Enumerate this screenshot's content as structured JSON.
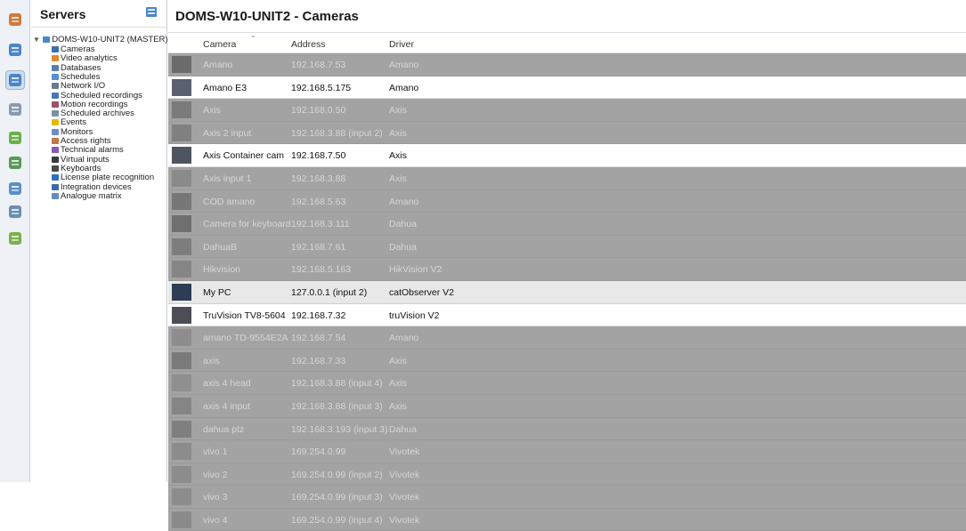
{
  "servers_panel": {
    "title": "Servers",
    "tree": {
      "root": "DOMS-W10-UNIT2 (MASTER)",
      "items": [
        {
          "label": "Cameras",
          "icon": "camera-icon",
          "color": "#3c6fb0"
        },
        {
          "label": "Video analytics",
          "icon": "analytics-icon",
          "color": "#e08a2c"
        },
        {
          "label": "Databases",
          "icon": "database-icon",
          "color": "#5a7fa8"
        },
        {
          "label": "Schedules",
          "icon": "schedule-icon",
          "color": "#5a8fd0"
        },
        {
          "label": "Network I/O",
          "icon": "network-io-icon",
          "color": "#6b7a8c"
        },
        {
          "label": "Scheduled recordings",
          "icon": "scheduled-recordings-icon",
          "color": "#4b76b8"
        },
        {
          "label": "Motion recordings",
          "icon": "motion-recordings-icon",
          "color": "#a0506a"
        },
        {
          "label": "Scheduled archives",
          "icon": "scheduled-archives-icon",
          "color": "#7b8fa8"
        },
        {
          "label": "Events",
          "icon": "events-icon",
          "color": "#e6b800"
        },
        {
          "label": "Monitors",
          "icon": "monitor-icon",
          "color": "#6a8fc8"
        },
        {
          "label": "Access rights",
          "icon": "access-rights-icon",
          "color": "#c07848"
        },
        {
          "label": "Technical alarms",
          "icon": "technical-alarms-icon",
          "color": "#8a5ab0"
        },
        {
          "label": "Virtual inputs",
          "icon": "virtual-inputs-icon",
          "color": "#3a3a3a"
        },
        {
          "label": "Keyboards",
          "icon": "keyboard-icon",
          "color": "#4a4a4a"
        },
        {
          "label": "License plate recognition",
          "icon": "lpr-icon",
          "color": "#2f6fbf"
        },
        {
          "label": "Integration devices",
          "icon": "integration-devices-icon",
          "color": "#3a6aa0"
        },
        {
          "label": "Analogue matrix",
          "icon": "analogue-matrix-icon",
          "color": "#5f8fbf"
        }
      ]
    }
  },
  "main": {
    "title": "DOMS-W10-UNIT2 - Cameras",
    "columns": {
      "camera": "Camera",
      "address": "Address",
      "driver": "Driver"
    },
    "rows": [
      {
        "camera": "Amano",
        "address": "192.168.7.53",
        "driver": "Amano",
        "state": "disabled"
      },
      {
        "camera": "Amano E3",
        "address": "192.168.5.175",
        "driver": "Amano",
        "state": "enabled"
      },
      {
        "camera": "Axis",
        "address": "192.168.0.50",
        "driver": "Axis",
        "state": "disabled"
      },
      {
        "camera": "Axis 2 input",
        "address": "192.168.3.88 (input 2)",
        "driver": "Axis",
        "state": "disabled"
      },
      {
        "camera": "Axis Container cam",
        "address": "192.168.7.50",
        "driver": "Axis",
        "state": "enabled"
      },
      {
        "camera": "Axis input 1",
        "address": "192.168.3.88",
        "driver": "Axis",
        "state": "disabled"
      },
      {
        "camera": "COD amano",
        "address": "192.168.5.63",
        "driver": "Amano",
        "state": "disabled"
      },
      {
        "camera": "Camera for keyboard",
        "address": "192.168.3.111",
        "driver": "Dahua",
        "state": "disabled"
      },
      {
        "camera": "DahuaB",
        "address": "192.168.7.61",
        "driver": "Dahua",
        "state": "disabled"
      },
      {
        "camera": "Hikvision",
        "address": "192.168.5.163",
        "driver": "HikVision V2",
        "state": "disabled"
      },
      {
        "camera": "My PC",
        "address": "127.0.0.1 (input 2)",
        "driver": "catObserver V2",
        "state": "selected"
      },
      {
        "camera": "TruVision TV8-5604",
        "address": "192.168.7.32",
        "driver": "truVision V2",
        "state": "enabled"
      },
      {
        "camera": "amano TD-9554E2A",
        "address": "192.168.7.54",
        "driver": "Amano",
        "state": "disabled"
      },
      {
        "camera": "axis",
        "address": "192.168.7.33",
        "driver": "Axis",
        "state": "disabled"
      },
      {
        "camera": "axis 4 head",
        "address": "192.168.3.88 (input 4)",
        "driver": "Axis",
        "state": "disabled"
      },
      {
        "camera": "axis 4 input",
        "address": "192.168.3.88 (input 3)",
        "driver": "Axis",
        "state": "disabled"
      },
      {
        "camera": "dahua ptz",
        "address": "192.168.3.193 (input 3)",
        "driver": "Dahua",
        "state": "disabled"
      },
      {
        "camera": "vivo 1",
        "address": "169.254.0.99",
        "driver": "Vivotek",
        "state": "disabled"
      },
      {
        "camera": "vivo 2",
        "address": "169.254.0.99 (input 2)",
        "driver": "Vivotek",
        "state": "disabled"
      },
      {
        "camera": "vivo 3",
        "address": "169.254.0.99 (input 3)",
        "driver": "Vivotek",
        "state": "disabled"
      },
      {
        "camera": "vivo 4",
        "address": "169.254.0.99 (input 4)",
        "driver": "Vivotek",
        "state": "disabled"
      }
    ]
  },
  "toolbar": {
    "tools": [
      {
        "name": "home-icon",
        "color": "#d07a3a"
      },
      {
        "name": "user-icon",
        "color": "#4a86c8"
      },
      {
        "name": "servers-icon",
        "color": "#4a86c8"
      },
      {
        "name": "document-icon",
        "color": "#8a9ab0"
      },
      {
        "name": "plugin-icon",
        "color": "#6ab04c"
      },
      {
        "name": "database-icon",
        "color": "#5a9a5a"
      },
      {
        "name": "display-icon",
        "color": "#5a8fc8"
      },
      {
        "name": "network-icon",
        "color": "#6a8fb0"
      },
      {
        "name": "tree-icon",
        "color": "#7ab04a"
      }
    ]
  }
}
